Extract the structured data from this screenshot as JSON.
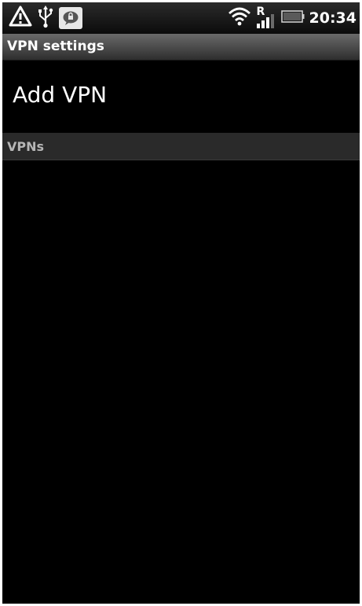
{
  "status_bar": {
    "time": "20:34",
    "icons": [
      "warning-icon",
      "usb-icon",
      "message-icon",
      "wifi-icon",
      "signal-roaming-icon",
      "battery-icon"
    ],
    "roaming_indicator": "R"
  },
  "header": {
    "title": "VPN settings"
  },
  "main": {
    "add_vpn_label": "Add VPN",
    "section_title": "VPNs"
  },
  "colors": {
    "background": "#000000",
    "title_bar": "#4a4a4a",
    "section_bar": "#2a2a2a",
    "section_text": "#b5b5b5"
  }
}
